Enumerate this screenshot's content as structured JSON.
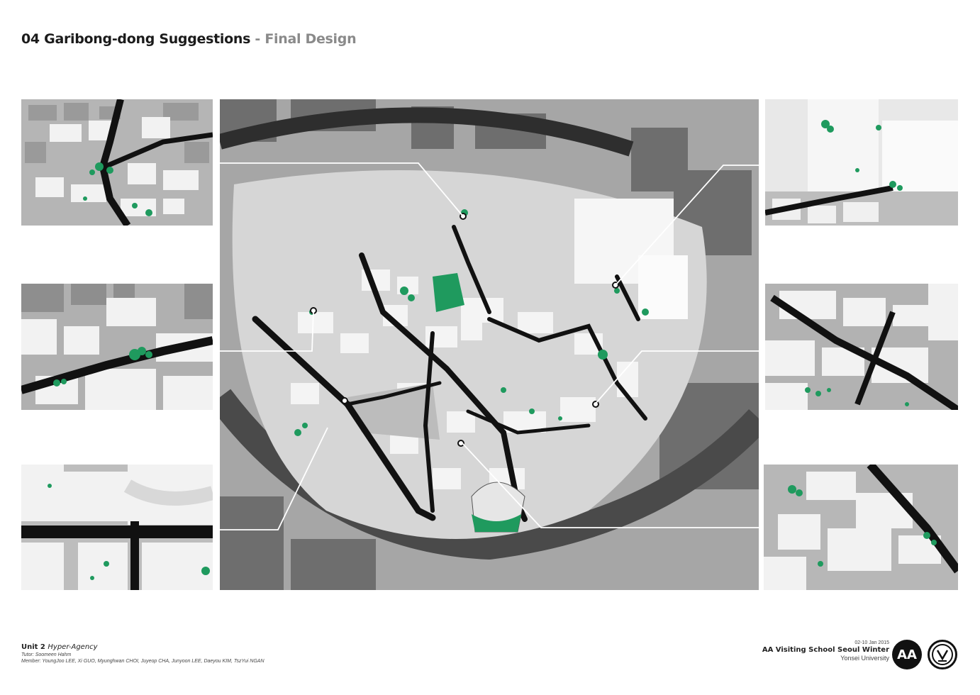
{
  "header": {
    "title": "04 Garibong-dong Suggestions",
    "separator": " - ",
    "subtitle": "Final Design"
  },
  "footer": {
    "unit_label": "Unit 2",
    "unit_name": "Hyper-Agency",
    "tutor": "Tutor: Soomeen Hahm",
    "members": "Member: YoungJoo LEE, Xi GUO, Myunghwan CHOI, Juyeop CHA, Junyoon LEE, Daeyou KIM, TszYui NGAN",
    "date": "02-10 Jan 2015",
    "school": "AA Visiting School Seoul Winter",
    "university": "Yonsei University"
  },
  "logos": {
    "aa": "AA",
    "yonsei": "yonsei-seal-icon"
  },
  "colors": {
    "accent_green": "#1f9a5e",
    "street_black": "#111111",
    "building_white": "#f3f3f3",
    "building_grey": "#8d8d8d"
  }
}
